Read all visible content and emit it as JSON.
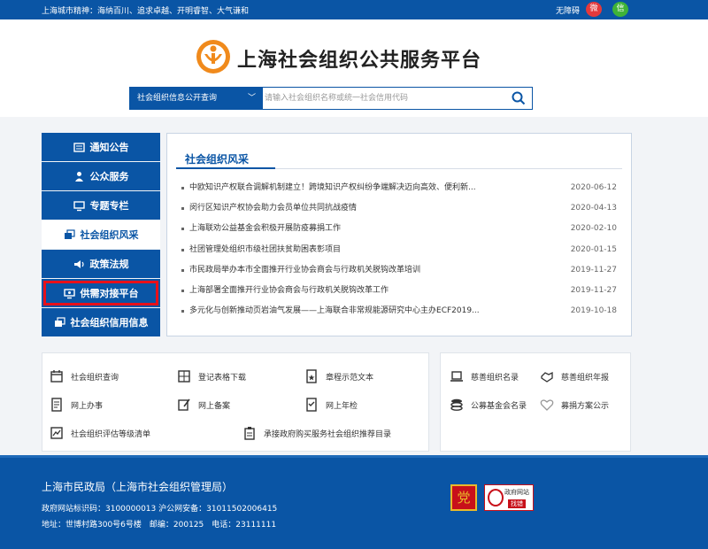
{
  "topbar": {
    "spirit": "上海城市精神：海纳百川、追求卓越、开明睿智、大气谦和",
    "accessibility": "无障碍",
    "weibo": "微",
    "wechat": "信"
  },
  "header": {
    "title": "上海社会组织公共服务平台"
  },
  "search": {
    "category": "社会组织信息公开查询",
    "placeholder": "请输入社会组织名称或统一社会信用代码"
  },
  "sidebar": {
    "items": [
      {
        "label": "通知公告"
      },
      {
        "label": "公众服务"
      },
      {
        "label": "专题专栏"
      },
      {
        "label": "社会组织风采"
      },
      {
        "label": "政策法规"
      },
      {
        "label": "供需对接平台"
      },
      {
        "label": "社会组织信用信息"
      }
    ]
  },
  "news": {
    "title": "社会组织风采",
    "items": [
      {
        "text": "中欧知识产权联合调解机制建立！跨境知识产权纠纷争端解决迈向高效、便利新...",
        "date": "2020-06-12"
      },
      {
        "text": "闵行区知识产权协会助力会员单位共同抗战疫情",
        "date": "2020-04-13"
      },
      {
        "text": "上海联劝公益基金会积极开展防疫募捐工作",
        "date": "2020-02-10"
      },
      {
        "text": "社团管理处组织市级社团扶贫助困表彰项目",
        "date": "2020-01-15"
      },
      {
        "text": "市民政局举办本市全面推开行业协会商会与行政机关脱钩改革培训",
        "date": "2019-11-27"
      },
      {
        "text": "上海部署全面推开行业协会商会与行政机关脱钩改革工作",
        "date": "2019-11-27"
      },
      {
        "text": "多元化与创新推动页岩油气发展——上海联合非常规能源研究中心主办ECF2019...",
        "date": "2019-10-18"
      }
    ]
  },
  "services": {
    "query": "社会组织查询",
    "forms": "登记表格下载",
    "charter": "章程示范文本",
    "online": "网上办事",
    "filing": "网上备案",
    "annual": "网上年检",
    "rating": "社会组织评估等级清单",
    "purchase": "承接政府购买服务社会组织推荐目录"
  },
  "charity": {
    "list": "慈善组织名录",
    "report": "慈善组织年报",
    "foundation": "公募基金会名录",
    "fundraising": "募捐方案公示"
  },
  "footer": {
    "org": "上海市民政局（上海市社会组织管理局）",
    "ids": "政府网站标识码：3100000013 沪公网安备：31011502006415",
    "address": "地址：世博村路300号6号楼　邮编：200125　电话：23111111",
    "party_badge": "党",
    "gov_badge_top": "政府网站",
    "gov_badge_bottom": "找错"
  },
  "colors": {
    "brand_blue": "#0a55a5",
    "logo_orange": "#f08a1c",
    "highlight_red": "#e8101a"
  }
}
